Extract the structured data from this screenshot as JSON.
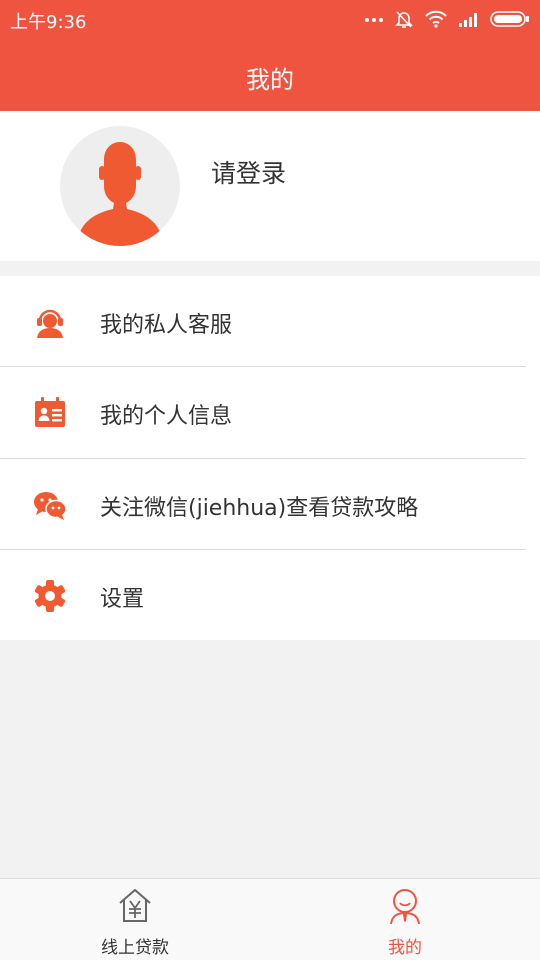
{
  "status_bar": {
    "time": "上午9:36",
    "icons": [
      "more-dots-icon",
      "bell-muted-icon",
      "wifi-icon",
      "signal-icon",
      "battery-icon"
    ]
  },
  "header": {
    "title": "我的"
  },
  "profile": {
    "login_prompt": "请登录",
    "avatar_icon": "user-silhouette-icon"
  },
  "menu": {
    "items": [
      {
        "label": "我的私人客服",
        "icon": "customer-service-icon"
      },
      {
        "label": "我的个人信息",
        "icon": "id-card-icon"
      },
      {
        "label": "关注微信(jiehhua)查看贷款攻略",
        "icon": "wechat-icon"
      },
      {
        "label": "设置",
        "icon": "gear-icon"
      }
    ]
  },
  "tab_bar": {
    "tabs": [
      {
        "label": "线上贷款",
        "icon": "house-yuan-icon",
        "active": false
      },
      {
        "label": "我的",
        "icon": "user-icon",
        "active": true
      }
    ]
  },
  "colors": {
    "accent": "#ef5440",
    "background": "#f2f2f2",
    "text": "#333333",
    "tab_inactive": "#333333",
    "tab_active": "#ef5440"
  }
}
